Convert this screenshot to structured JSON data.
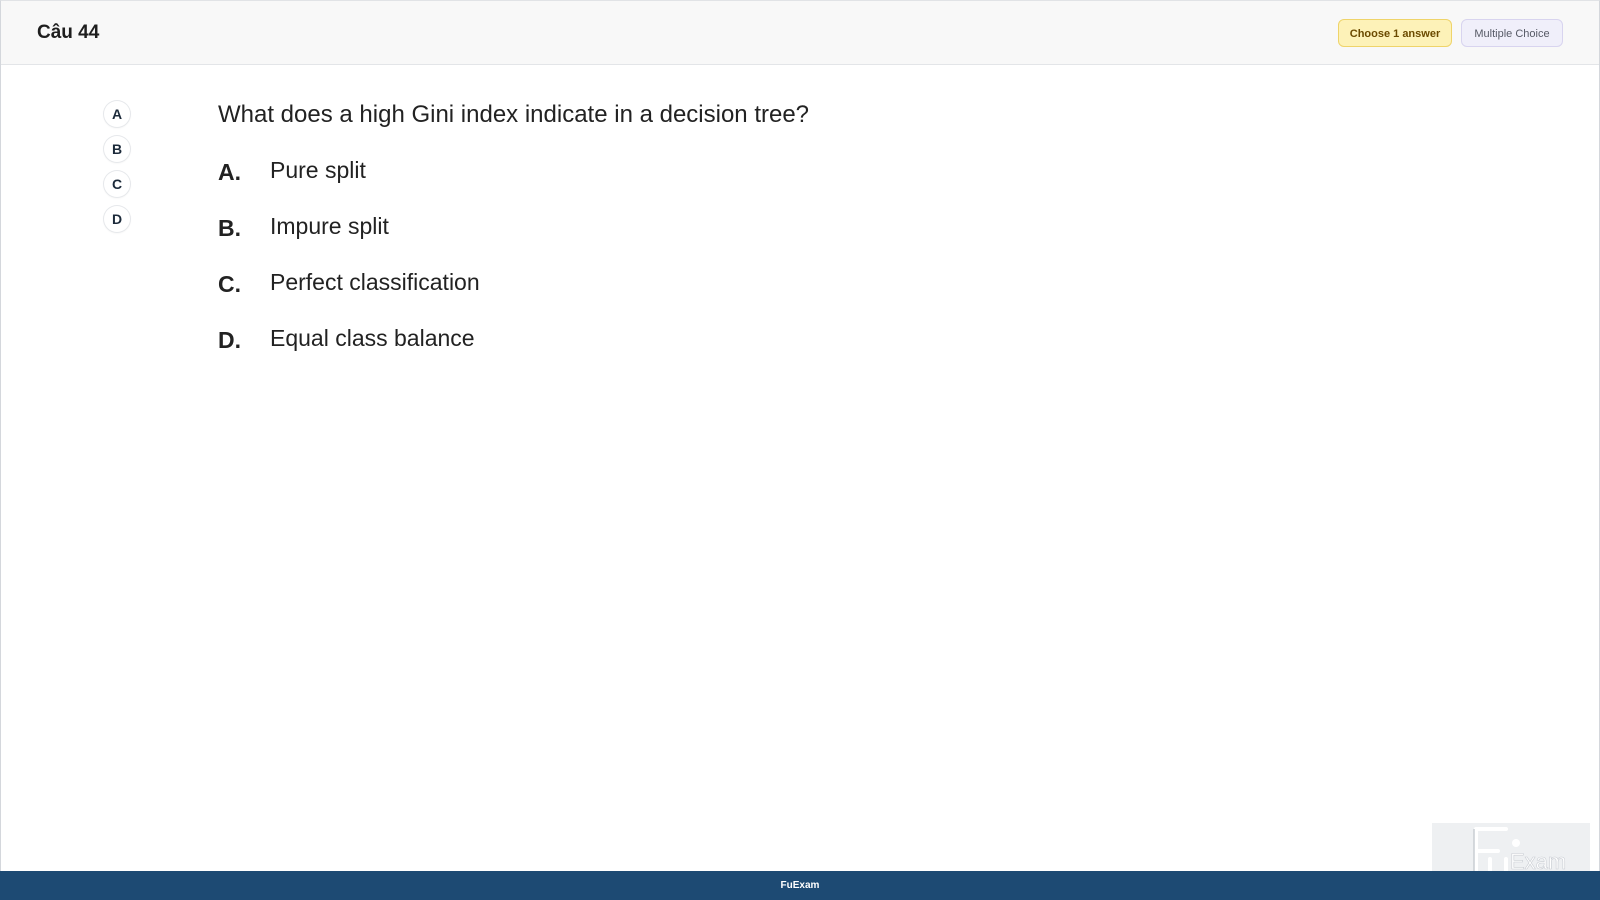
{
  "header": {
    "title": "Câu 44",
    "badge_choose": "Choose 1 answer",
    "badge_type": "Multiple Choice"
  },
  "side_nav": {
    "options": [
      "A",
      "B",
      "C",
      "D"
    ]
  },
  "question": {
    "text": "What does a high Gini index indicate in a decision tree?",
    "answers": [
      {
        "letter": "A.",
        "text": "Pure split"
      },
      {
        "letter": "B.",
        "text": "Impure split"
      },
      {
        "letter": "C.",
        "text": "Perfect classification"
      },
      {
        "letter": "D.",
        "text": "Equal class balance"
      }
    ]
  },
  "footer": {
    "label": "FuExam"
  },
  "logo": {
    "text": "FUExam",
    "icon": "fuexam-logo-icon"
  }
}
